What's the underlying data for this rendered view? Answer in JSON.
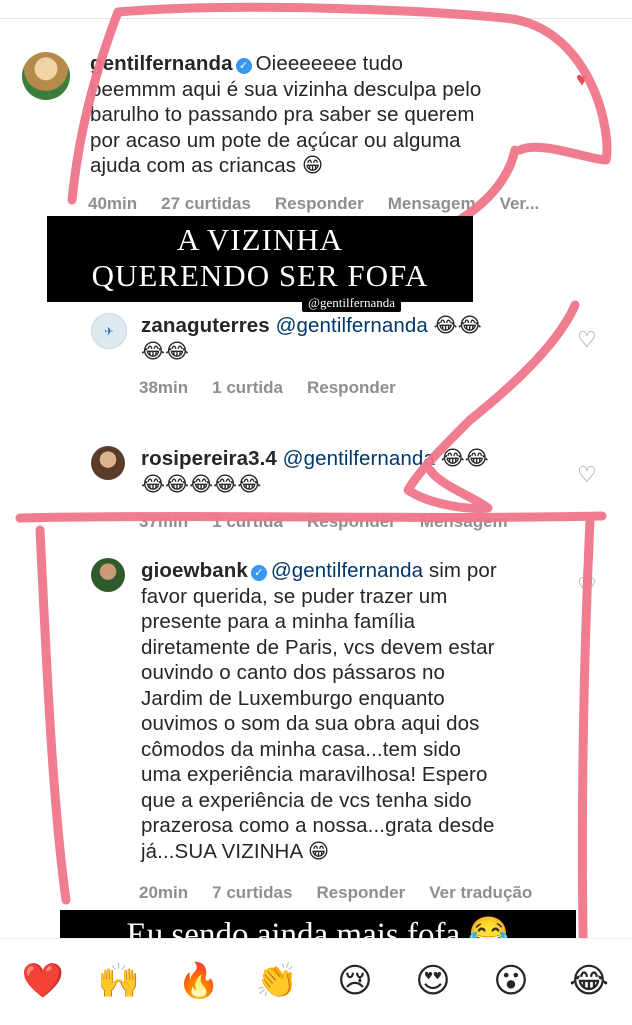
{
  "comments": [
    {
      "username": "gentilfernanda",
      "verified": true,
      "text": "Oieeeeeee tudo beemmm aqui é sua vizinha desculpa pelo barulho to passando pra saber se querem por acaso um pote de açúcar ou alguma ajuda com as criancas 😁",
      "lines": [
        "Oieeeeeee tudo",
        "beemmm aqui é sua vizinha desculpa pelo",
        "barulho to passando pra saber se querem",
        "por acaso um pote de açúcar ou alguma",
        "ajuda com as criancas 😁"
      ],
      "time": "40min",
      "likes": "27 curtidas",
      "reply": "Responder",
      "message": "Mensagem",
      "translate": "Ver...",
      "liked": true
    },
    {
      "username": "zanaguterres",
      "mention": "@gentilfernanda",
      "emoji_line1": "😂😂",
      "emoji_line2": "😂😂",
      "time": "38min",
      "likes": "1 curtida",
      "reply": "Responder"
    },
    {
      "username": "rosipereira3.4",
      "mention": "@gentilfernanda",
      "emoji_line1": "😂😂",
      "emoji_line2": "😂😂😂😂😂",
      "time": "37min",
      "likes": "1 curtida",
      "reply": "Responder",
      "message": "Mensagem"
    },
    {
      "username": "gioewbank",
      "verified": true,
      "mention": "@gentilfernanda",
      "first_tail": "sim por",
      "lines": [
        "favor querida, se puder trazer um",
        "presente para a minha família",
        "diretamente de Paris, vcs devem estar",
        "ouvindo o canto dos pássaros no",
        "Jardim de Luxemburgo enquanto",
        "ouvimos o som da sua obra aqui dos",
        "cômodos da minha casa...tem sido",
        "uma experiência maravilhosa! Espero",
        "que a experiência de vcs tenha sido",
        "prazerosa como a nossa...grata desde",
        "já...SUA VIZINHA 😁"
      ],
      "time": "20min",
      "likes": "7 curtidas",
      "reply": "Responder",
      "translate": "Ver tradução"
    }
  ],
  "overlays": {
    "caption_top_line1": "A VIZINHA",
    "caption_top_line2": "QUERENDO SER FOFA",
    "mention_tag": "@gentilfernanda",
    "caption_bottom": "Eu sendo ainda mais fofa 😂"
  },
  "emoji_bar": [
    "❤️",
    "🙌",
    "🔥",
    "👏",
    "😢",
    "😍",
    "😮",
    "😂"
  ],
  "colors": {
    "scribble": "#f0768a",
    "like": "#ed4956",
    "mention": "#00376b",
    "meta": "#8e8e8e",
    "verified": "#3897f0"
  }
}
